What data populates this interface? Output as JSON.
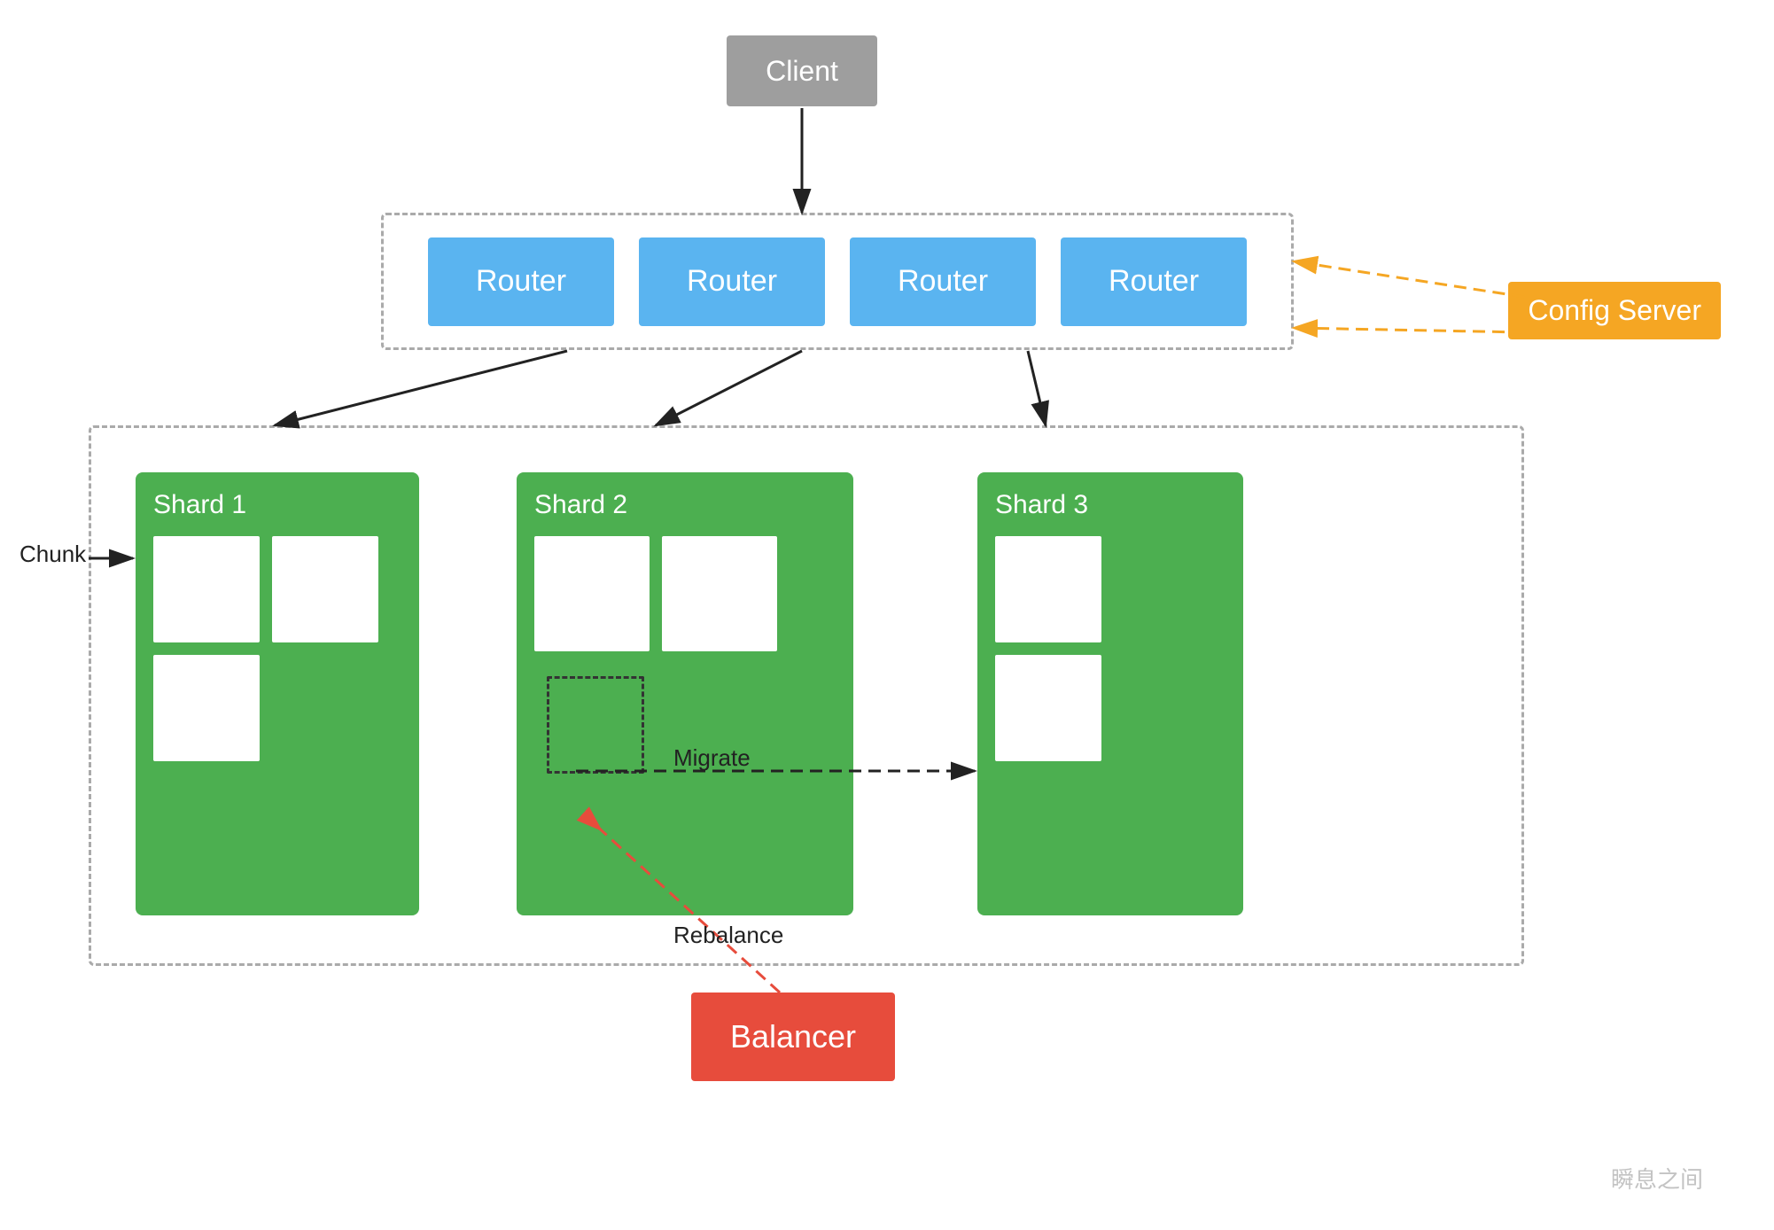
{
  "client": {
    "label": "Client"
  },
  "routers": [
    {
      "label": "Router"
    },
    {
      "label": "Router"
    },
    {
      "label": "Router"
    },
    {
      "label": "Router"
    }
  ],
  "config_server": {
    "label": "Config Server"
  },
  "shards": [
    {
      "label": "Shard 1"
    },
    {
      "label": "Shard 2"
    },
    {
      "label": "Shard 3"
    }
  ],
  "chunk_label": "Chunk",
  "migrate_label": "Migrate",
  "rebalance_label": "Rebalance",
  "balancer": {
    "label": "Balancer"
  },
  "watermark": "瞬息之间"
}
